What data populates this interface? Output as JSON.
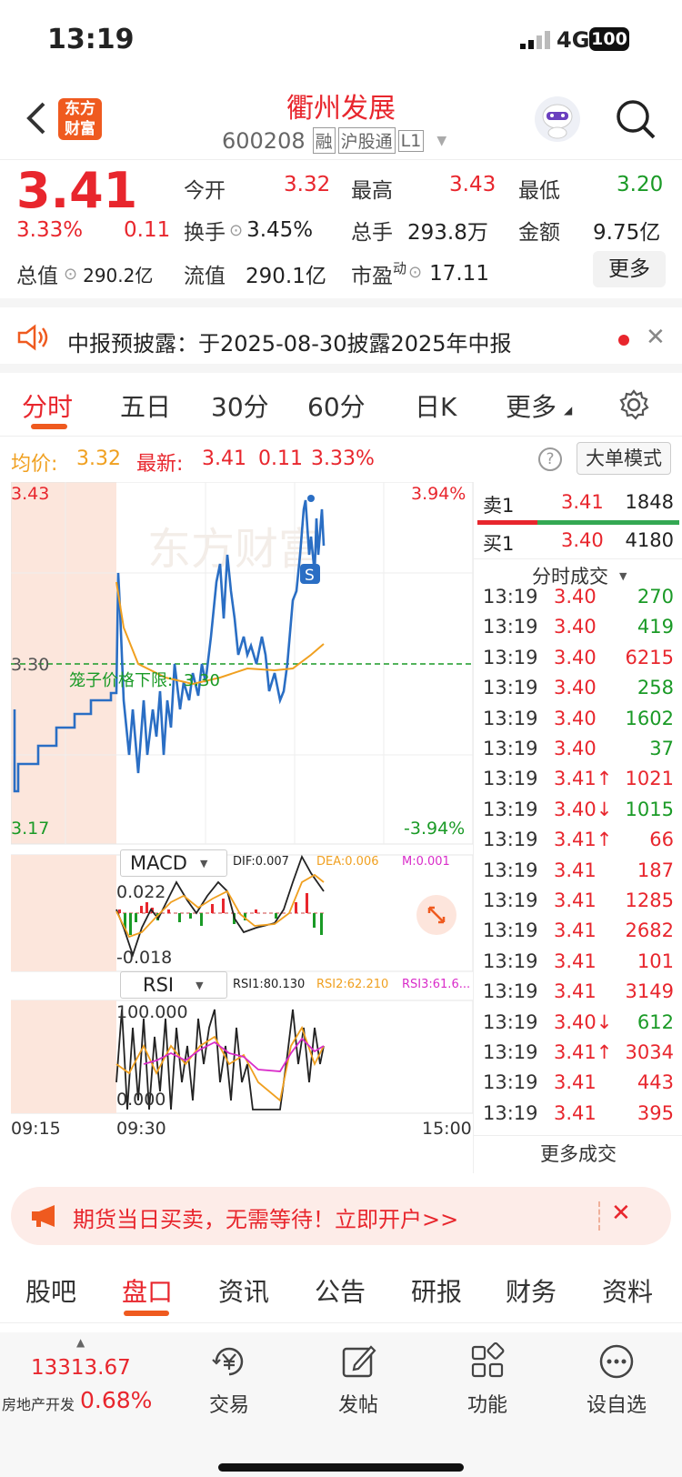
{
  "status": {
    "time": "13:19",
    "network": "4G",
    "battery": "100"
  },
  "header": {
    "logo_top": "东方",
    "logo_bottom": "财富",
    "name": "衢州发展",
    "code": "600208",
    "tag1": "融",
    "tag2": "沪股通",
    "tag3": "L1"
  },
  "quote": {
    "price": "3.41",
    "change_pct": "3.33%",
    "change": "0.11",
    "open_label": "今开",
    "open": "3.32",
    "high_label": "最高",
    "high": "3.43",
    "low_label": "最低",
    "low": "3.20",
    "turnover_label": "换手",
    "turnover": "3.45%",
    "volume_label": "总手",
    "volume": "293.8万",
    "amount_label": "金额",
    "amount": "9.75亿",
    "mktcap_label": "总值",
    "mktcap": "290.2亿",
    "float_label": "流值",
    "float": "290.1亿",
    "pe_label": "市盈",
    "pe_sup": "动",
    "pe": "17.11",
    "more": "更多"
  },
  "notice": {
    "text": "中报预披露：于2025-08-30披露2025年中报"
  },
  "tabs": [
    "分时",
    "五日",
    "30分",
    "60分",
    "日K",
    "更多"
  ],
  "info": {
    "avg_label": "均价:",
    "avg": "3.32",
    "latest_label": "最新:",
    "latest": "3.41",
    "chg": "0.11",
    "pct": "3.33%",
    "mode": "大单模式"
  },
  "chart": {
    "ymax": "3.43",
    "ymid": "3.30",
    "ymin": "3.17",
    "pmax": "3.94%",
    "pmin": "-3.94%",
    "limit_label": "笼子价格下限:",
    "limit_value": "3.30",
    "marker": "S",
    "times": [
      "09:15",
      "09:30",
      "15:00"
    ],
    "macd_label": "MACD",
    "dif": "DIF:0.007",
    "dea": "DEA:0.006",
    "m": "M:0.001",
    "macd_max": "0.022",
    "macd_min": "-0.018",
    "rsi_label": "RSI",
    "rsi1": "RSI1:80.130",
    "rsi2": "RSI2:62.210",
    "rsi3": "RSI3:61.6...",
    "rsi_max": "100.000",
    "rsi_min": "0.000"
  },
  "orderbook": {
    "sell_label": "卖1",
    "sell_price": "3.41",
    "sell_vol": "1848",
    "buy_label": "买1",
    "buy_price": "3.40",
    "buy_vol": "4180",
    "ticks_label": "分时成交",
    "more_label": "更多成交"
  },
  "trades": [
    {
      "t": "13:19",
      "p": "3.40",
      "v": "270",
      "c": "green"
    },
    {
      "t": "13:19",
      "p": "3.40",
      "v": "419",
      "c": "green"
    },
    {
      "t": "13:19",
      "p": "3.40",
      "v": "6215",
      "c": "red"
    },
    {
      "t": "13:19",
      "p": "3.40",
      "v": "258",
      "c": "green"
    },
    {
      "t": "13:19",
      "p": "3.40",
      "v": "1602",
      "c": "green"
    },
    {
      "t": "13:19",
      "p": "3.40",
      "v": "37",
      "c": "green"
    },
    {
      "t": "13:19",
      "p": "3.41↑",
      "v": "1021",
      "c": "red"
    },
    {
      "t": "13:19",
      "p": "3.40↓",
      "v": "1015",
      "c": "green"
    },
    {
      "t": "13:19",
      "p": "3.41↑",
      "v": "66",
      "c": "red"
    },
    {
      "t": "13:19",
      "p": "3.41",
      "v": "187",
      "c": "red"
    },
    {
      "t": "13:19",
      "p": "3.41",
      "v": "1285",
      "c": "red"
    },
    {
      "t": "13:19",
      "p": "3.41",
      "v": "2682",
      "c": "red"
    },
    {
      "t": "13:19",
      "p": "3.41",
      "v": "101",
      "c": "red"
    },
    {
      "t": "13:19",
      "p": "3.41",
      "v": "3149",
      "c": "red"
    },
    {
      "t": "13:19",
      "p": "3.40↓",
      "v": "612",
      "c": "green"
    },
    {
      "t": "13:19",
      "p": "3.41↑",
      "v": "3034",
      "c": "red"
    },
    {
      "t": "13:19",
      "p": "3.41",
      "v": "443",
      "c": "red"
    },
    {
      "t": "13:19",
      "p": "3.41",
      "v": "395",
      "c": "red"
    }
  ],
  "promo": {
    "text": "期货当日买卖，无需等待！立即开户>>"
  },
  "bottom_tabs": [
    "股吧",
    "盘口",
    "资讯",
    "公告",
    "研报",
    "财务",
    "资料"
  ],
  "dock": {
    "index_value": "13313.67",
    "index_name": "房地产开发",
    "index_pct": "0.68%",
    "trade": "交易",
    "post": "发帖",
    "func": "功能",
    "watch": "设自选"
  }
}
